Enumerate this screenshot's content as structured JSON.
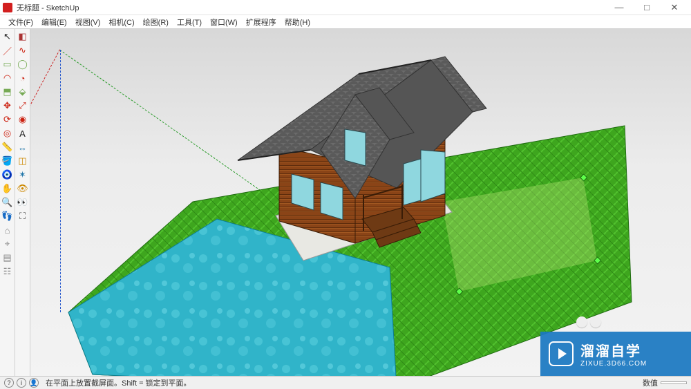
{
  "window": {
    "title": "无标题 - SketchUp",
    "min": "—",
    "max": "□",
    "close": "✕"
  },
  "menu": {
    "items": [
      {
        "label": "文件(F)"
      },
      {
        "label": "编辑(E)"
      },
      {
        "label": "视图(V)"
      },
      {
        "label": "相机(C)"
      },
      {
        "label": "绘图(R)"
      },
      {
        "label": "工具(T)"
      },
      {
        "label": "窗口(W)"
      },
      {
        "label": "扩展程序"
      },
      {
        "label": "帮助(H)"
      }
    ]
  },
  "tools_col1": [
    {
      "name": "select-tool",
      "glyph": "↖",
      "color": "#222"
    },
    {
      "name": "line-tool",
      "glyph": "／",
      "color": "#c21"
    },
    {
      "name": "rectangle-tool",
      "glyph": "▭",
      "color": "#7a5"
    },
    {
      "name": "arc-tool",
      "glyph": "◠",
      "color": "#c21"
    },
    {
      "name": "push-pull-tool",
      "glyph": "⬒",
      "color": "#7a5"
    },
    {
      "name": "move-tool",
      "glyph": "✥",
      "color": "#c21"
    },
    {
      "name": "rotate-tool",
      "glyph": "⟳",
      "color": "#c21"
    },
    {
      "name": "offset-tool",
      "glyph": "◎",
      "color": "#c21"
    },
    {
      "name": "tape-measure-tool",
      "glyph": "📏",
      "color": "#999"
    },
    {
      "name": "paint-bucket-tool",
      "glyph": "🪣",
      "color": "#c80"
    },
    {
      "name": "orbit-tool",
      "glyph": "🧿",
      "color": "#27a"
    },
    {
      "name": "pan-tool",
      "glyph": "✋",
      "color": "#c80"
    },
    {
      "name": "zoom-tool",
      "glyph": "🔍",
      "color": "#27a"
    },
    {
      "name": "walk-tool",
      "glyph": "👣",
      "color": "#555"
    },
    {
      "name": "warehouse-tool",
      "glyph": "⌂",
      "color": "#888"
    },
    {
      "name": "location-tool",
      "glyph": "⌖",
      "color": "#888"
    },
    {
      "name": "layers-tool",
      "glyph": "▤",
      "color": "#888"
    },
    {
      "name": "scenes-tool",
      "glyph": "☷",
      "color": "#888"
    }
  ],
  "tools_col2": [
    {
      "name": "eraser-tool",
      "glyph": "◧",
      "color": "#a33"
    },
    {
      "name": "freehand-tool",
      "glyph": "∿",
      "color": "#c21"
    },
    {
      "name": "circle-tool",
      "glyph": "◯",
      "color": "#7a5"
    },
    {
      "name": "pie-tool",
      "glyph": "◔",
      "color": "#c21"
    },
    {
      "name": "follow-me-tool",
      "glyph": "⬙",
      "color": "#7a5"
    },
    {
      "name": "scale-tool",
      "glyph": "⤢",
      "color": "#c21"
    },
    {
      "name": "protractor-tool",
      "glyph": "◉",
      "color": "#c21"
    },
    {
      "name": "text-tool",
      "glyph": "A",
      "color": "#222"
    },
    {
      "name": "dimension-tool",
      "glyph": "↔",
      "color": "#27a"
    },
    {
      "name": "section-tool",
      "glyph": "◫",
      "color": "#c80"
    },
    {
      "name": "axes-tool",
      "glyph": "✶",
      "color": "#27a"
    },
    {
      "name": "position-camera-tool",
      "glyph": "👁",
      "color": "#c80"
    },
    {
      "name": "look-around-tool",
      "glyph": "👀",
      "color": "#27a"
    },
    {
      "name": "zoom-extents-tool",
      "glyph": "⛶",
      "color": "#555"
    }
  ],
  "status": {
    "icons": [
      "?",
      "i",
      "👤"
    ],
    "hint": "在平面上放置截屏面。Shift = 锁定到平面。",
    "value_label": "数值",
    "value": ""
  },
  "watermark": {
    "zh": "溜溜自学",
    "en": "ZIXUE.3D66.COM"
  }
}
